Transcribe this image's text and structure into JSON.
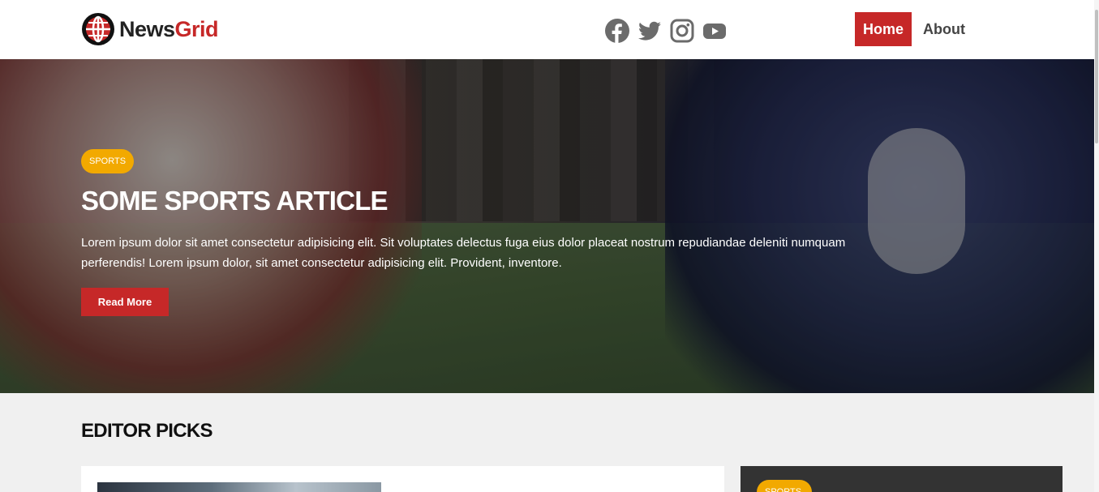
{
  "header": {
    "logo": {
      "part1": "News",
      "part2": "Grid"
    },
    "socials": [
      {
        "name": "facebook-icon"
      },
      {
        "name": "twitter-icon"
      },
      {
        "name": "instagram-icon"
      },
      {
        "name": "youtube-icon"
      }
    ],
    "nav": {
      "home": "Home",
      "about": "About"
    }
  },
  "hero": {
    "badge": "SPORTS",
    "title": "SOME SPORTS ARTICLE",
    "text": "Lorem ipsum dolor sit amet consectetur adipisicing elit. Sit voluptates delectus fuga eius dolor placeat nostrum repudiandae deleniti numquam perferendis! Lorem ipsum dolor, sit amet consectetur adipisicing elit. Provident, inventore.",
    "button": "Read More"
  },
  "editor_picks": {
    "title": "EDITOR PICKS",
    "side_badge": "SPORTS"
  },
  "colors": {
    "brand_red": "#c62828",
    "badge_yellow": "#f2a900",
    "icon_gray": "#6b6b6b"
  }
}
